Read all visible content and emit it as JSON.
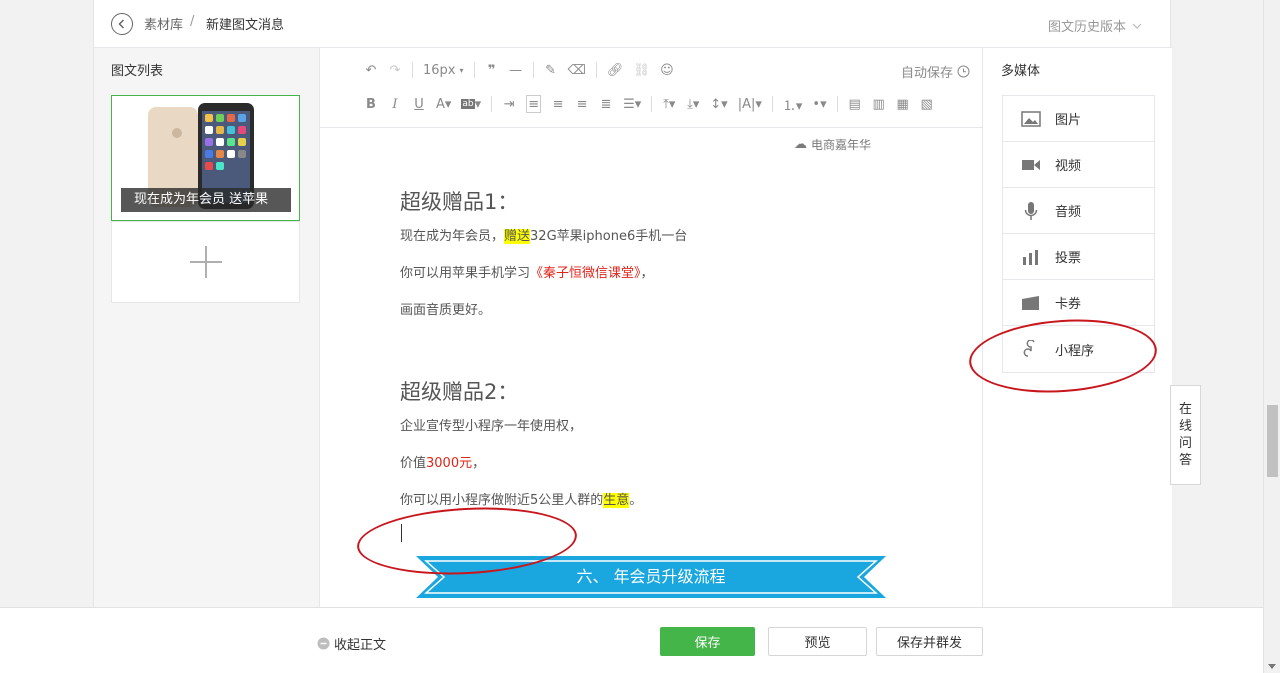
{
  "header": {
    "crumb_library": "素材库",
    "crumb_sep": "/",
    "crumb_current": "新建图文消息",
    "history_label": "图文历史版本"
  },
  "left_panel": {
    "title": "图文列表",
    "article_caption": "现在成为年会员 送苹果"
  },
  "toolbar": {
    "font_size": "16px",
    "autosave_label": "自动保存"
  },
  "content": {
    "watermark": "电商嘉年华",
    "gift1_title": "超级赠品1：",
    "gift1_line1_a": "现在成为年会员，",
    "gift1_line1_hl": "赠送",
    "gift1_line1_b": "32G苹果iphone6手机一台",
    "gift1_line2_a": "你可以用苹果手机学习",
    "gift1_line2_red": "《秦子恒微信课堂》",
    "gift1_line2_b": "，",
    "gift1_line3": "画面音质更好。",
    "gift2_title": "超级赠品2：",
    "gift2_line1": "企业宣传型小程序一年使用权，",
    "gift2_line2_a": "价值",
    "gift2_line2_red": "3000元",
    "gift2_line2_b": "，",
    "gift2_line3_a": "你可以用小程序做附近5公里人群的",
    "gift2_line3_hl": "生意",
    "gift2_line3_b": "。",
    "banner_text": "六、 年会员升级流程"
  },
  "right_panel": {
    "title": "多媒体",
    "items": [
      {
        "label": "图片",
        "icon": "image-icon"
      },
      {
        "label": "视频",
        "icon": "video-icon"
      },
      {
        "label": "音频",
        "icon": "audio-icon"
      },
      {
        "label": "投票",
        "icon": "vote-icon"
      },
      {
        "label": "卡券",
        "icon": "card-coupon-icon"
      },
      {
        "label": "小程序",
        "icon": "mini-program-icon"
      }
    ]
  },
  "help_tab": [
    "在",
    "线",
    "问",
    "答"
  ],
  "bottom": {
    "collapse_label": "收起正文",
    "save_label": "保存",
    "preview_label": "预览",
    "save_send_label": "保存并群发"
  },
  "colors": {
    "accent_green": "#44b549",
    "annotation_red": "#c8161d",
    "banner_blue": "#1aa7e0",
    "highlight_yellow": "#ffff00"
  }
}
